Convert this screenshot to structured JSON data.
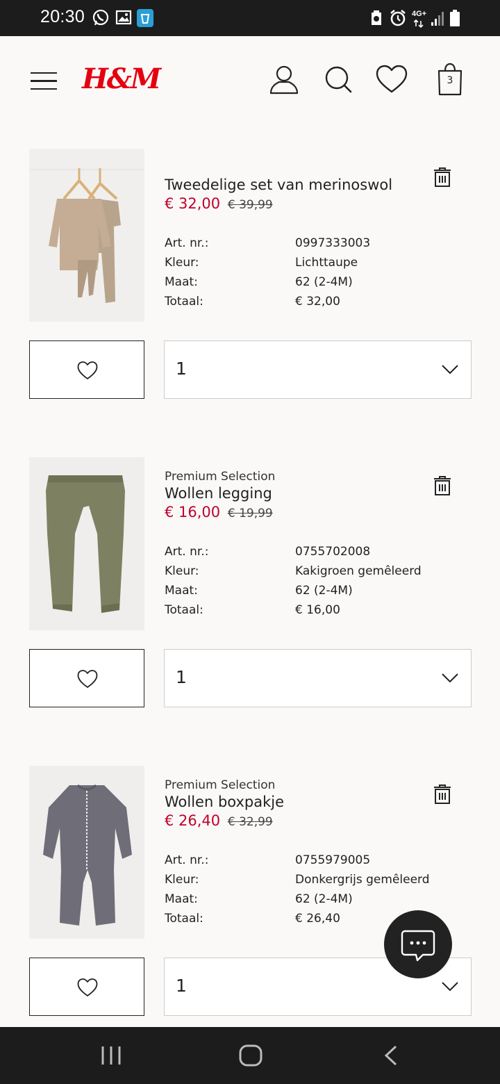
{
  "status_bar": {
    "time": "20:30",
    "network": "4G+"
  },
  "header": {
    "logo": "H&M",
    "cart_count": "3"
  },
  "detail_labels": {
    "art": "Art. nr.:",
    "color": "Kleur:",
    "size": "Maat:",
    "total": "Totaal:"
  },
  "items": [
    {
      "brand": "",
      "name": "Tweedelige set van merinoswol",
      "price": "€ 32,00",
      "old_price": "€ 39,99",
      "art_nr": "0997333003",
      "color": "Lichttaupe",
      "size": "62 (2-4M)",
      "total": "€ 32,00",
      "quantity": "1"
    },
    {
      "brand": "Premium Selection",
      "name": "Wollen legging",
      "price": "€ 16,00",
      "old_price": "€ 19,99",
      "art_nr": "0755702008",
      "color": "Kakigroen gemêleerd",
      "size": "62 (2-4M)",
      "total": "€ 16,00",
      "quantity": "1"
    },
    {
      "brand": "Premium Selection",
      "name": "Wollen boxpakje",
      "price": "€ 26,40",
      "old_price": "€ 32,99",
      "art_nr": "0755979005",
      "color": "Donkergrijs gemêleerd",
      "size": "62 (2-4M)",
      "total": "€ 26,40",
      "quantity": "1"
    }
  ],
  "colors": {
    "accent": "#e50010",
    "sale_price": "#c0002c",
    "background": "#faf9f8"
  }
}
